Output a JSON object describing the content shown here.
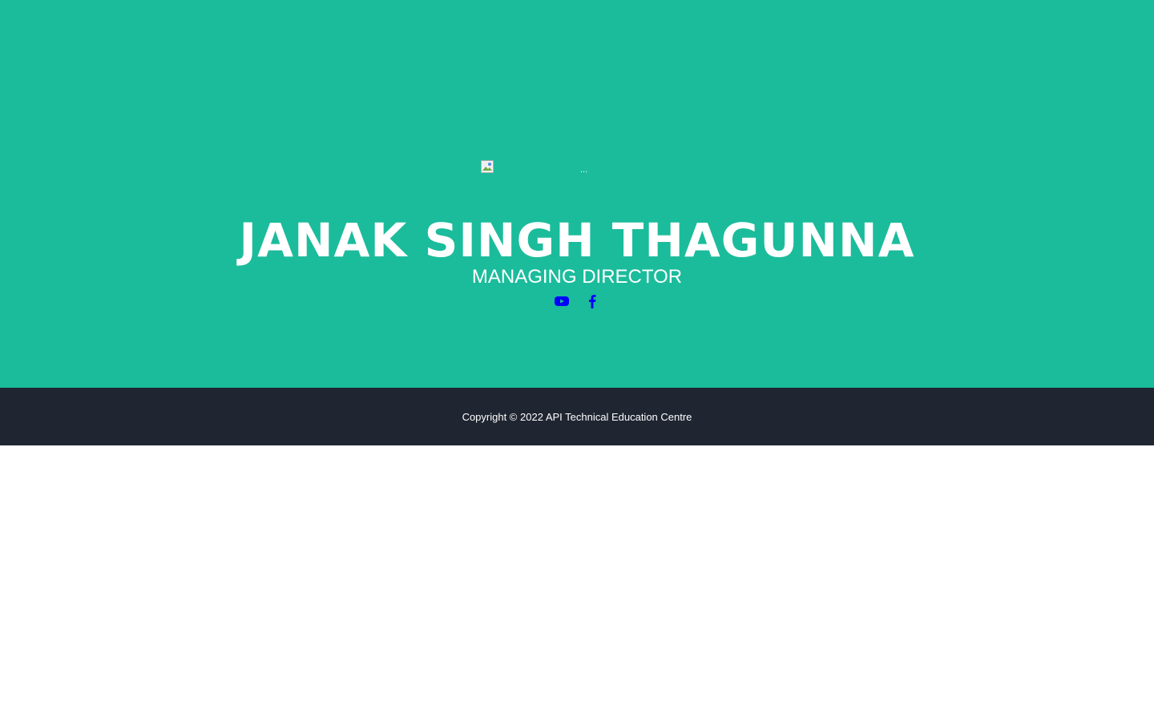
{
  "hero": {
    "image_alt": "...",
    "name": "JANAK SINGH THAGUNNA",
    "role": "MANAGING DIRECTOR",
    "social": [
      {
        "icon": "youtube-icon",
        "color": "#0000ff"
      },
      {
        "icon": "facebook-icon",
        "color": "#0000ff"
      }
    ],
    "background_color": "#1bbc9b"
  },
  "footer": {
    "copyright": "Copyright © 2022 API Technical Education Centre",
    "background_color": "#1f2531"
  }
}
